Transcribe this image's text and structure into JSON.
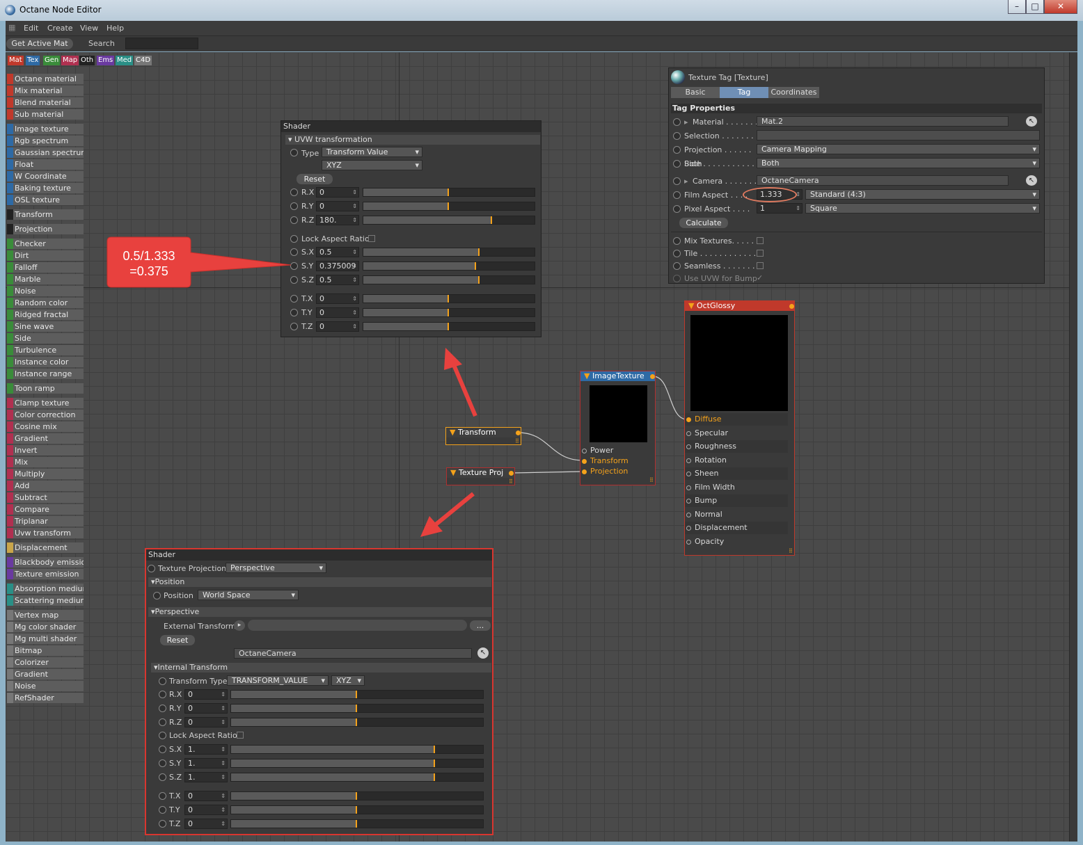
{
  "window": {
    "title": "Octane Node Editor",
    "buttons": [
      "–",
      "□",
      "✕"
    ]
  },
  "menu": [
    "Edit",
    "Create",
    "View",
    "Help"
  ],
  "toolbar": {
    "get_active_mat": "Get Active Mat",
    "search_label": "Search",
    "search_value": ""
  },
  "categories": [
    {
      "label": "Mat",
      "color": "#c0392b"
    },
    {
      "label": "Tex",
      "color": "#2e6aa5"
    },
    {
      "label": "Gen",
      "color": "#3a8c3a"
    },
    {
      "label": "Map",
      "color": "#b03050"
    },
    {
      "label": "Oth",
      "color": "#222222"
    },
    {
      "label": "Ems",
      "color": "#6a3aa0"
    },
    {
      "label": "Med",
      "color": "#2a8f86"
    },
    {
      "label": "C4D",
      "color": "#777777"
    }
  ],
  "library": [
    "Octane material",
    "Mix material",
    "Blend material",
    "Sub material",
    "Image texture",
    "Rgb spectrum",
    "Gaussian spectrum",
    "Float",
    "W Coordinate",
    "Baking texture",
    "OSL texture",
    "Transform",
    "Projection",
    "Checker",
    "Dirt",
    "Falloff",
    "Marble",
    "Noise",
    "Random color",
    "Ridged fractal",
    "Sine wave",
    "Side",
    "Turbulence",
    "Instance color",
    "Instance range",
    "Toon ramp",
    "Clamp texture",
    "Color correction",
    "Cosine mix",
    "Gradient",
    "Invert",
    "Mix",
    "Multiply",
    "Add",
    "Subtract",
    "Compare",
    "Triplanar",
    "Uvw transform",
    "Displacement",
    "Blackbody emission",
    "Texture emission",
    "Absorption medium",
    "Scattering medium",
    "Vertex map",
    "Mg color shader",
    "Mg multi shader",
    "Bitmap",
    "Colorizer",
    "Gradient",
    "Noise",
    "RefShader"
  ],
  "shader_top": {
    "header": "Shader",
    "section": "UVW transformation",
    "type_label": "Type",
    "type_value": "Transform Value",
    "order_value": "XYZ",
    "reset": "Reset",
    "lock_label": "Lock Aspect Ratio",
    "rows": [
      {
        "label": "R.X",
        "value": "0",
        "pos": 0.5
      },
      {
        "label": "R.Y",
        "value": "0",
        "pos": 0.5
      },
      {
        "label": "R.Z",
        "value": "180.",
        "pos": 0.75
      },
      {
        "label": "S.X",
        "value": "0.5",
        "pos": 0.68
      },
      {
        "label": "S.Y",
        "value": "0.375009",
        "pos": 0.66
      },
      {
        "label": "S.Z",
        "value": "0.5",
        "pos": 0.68
      },
      {
        "label": "T.X",
        "value": "0",
        "pos": 0.5
      },
      {
        "label": "T.Y",
        "value": "0",
        "pos": 0.5
      },
      {
        "label": "T.Z",
        "value": "0",
        "pos": 0.5
      }
    ]
  },
  "callout": {
    "line1": "0.5/1.333",
    "line2": "=0.375"
  },
  "texture_tag": {
    "title": "Texture Tag [Texture]",
    "tabs": [
      "Basic",
      "Tag",
      "Coordinates"
    ],
    "section": "Tag Properties",
    "material_label": "Material . . . . . . .",
    "material_value": "Mat.2",
    "selection_label": "Selection . . . . . . .",
    "projection_label": "Projection . . . . . .",
    "projection_value": "Camera Mapping",
    "side_label": "Side . . . . . . . . . . .",
    "side_value": "Both",
    "camera_label": "Camera . . . . . . .",
    "camera_value": "OctaneCamera",
    "film_aspect_label": "Film Aspect . . . .",
    "film_aspect_value": "1.333",
    "film_aspect_preset": "Standard (4:3)",
    "pixel_aspect_label": "Pixel Aspect . . . .",
    "pixel_aspect_value": "1",
    "pixel_aspect_preset": "Square",
    "calculate": "Calculate",
    "mix_textures": "Mix Textures. . . . . .",
    "tile": "Tile . . . . . . . . . . . . .",
    "seamless": "Seamless . . . . . . . .",
    "use_uvw": "Use UVW for Bump"
  },
  "nodes": {
    "transform": "Transform",
    "texture_proj": "Texture Proj",
    "image_texture": {
      "title": "ImageTexture",
      "pins": [
        "Power",
        "Transform",
        "Projection"
      ]
    },
    "oct_glossy": {
      "title": "OctGlossy",
      "pins": [
        "Diffuse",
        "Specular",
        "Roughness",
        "Rotation",
        "Sheen",
        "Film Width",
        "Bump",
        "Normal",
        "Displacement",
        "Opacity"
      ]
    }
  },
  "shader_bottom": {
    "header": "Shader",
    "tex_proj_label": "Texture Projection",
    "tex_proj_value": "Perspective",
    "position_section": "Position",
    "position_label": "Position",
    "position_value": "World Space",
    "perspective_section": "Perspective",
    "external_transform": "External Transform",
    "ellipsis": "...",
    "reset": "Reset",
    "camera_value": "OctaneCamera",
    "internal_section": "Internal Transform",
    "transform_type_label": "Transform Type",
    "transform_type_value": "TRANSFORM_VALUE",
    "order_value": "XYZ",
    "lock_label": "Lock Aspect Ratio",
    "rows": [
      {
        "label": "R.X",
        "value": "0",
        "pos": 0.5
      },
      {
        "label": "R.Y",
        "value": "0",
        "pos": 0.5
      },
      {
        "label": "R.Z",
        "value": "0",
        "pos": 0.5
      },
      {
        "label": "S.X",
        "value": "1.",
        "pos": 0.81
      },
      {
        "label": "S.Y",
        "value": "1.",
        "pos": 0.81
      },
      {
        "label": "S.Z",
        "value": "1.",
        "pos": 0.81
      },
      {
        "label": "T.X",
        "value": "0",
        "pos": 0.5
      },
      {
        "label": "T.Y",
        "value": "0",
        "pos": 0.5
      },
      {
        "label": "T.Z",
        "value": "0",
        "pos": 0.5
      }
    ]
  },
  "colors": {
    "accent": "#f4a21b",
    "callout": "#e8413e",
    "highlight": "#d9362f",
    "film_circle": "#e07a5f"
  }
}
